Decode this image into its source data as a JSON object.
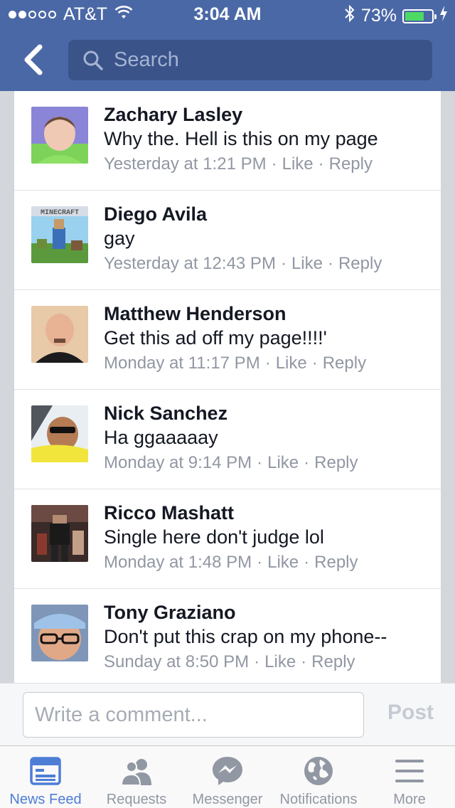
{
  "status_bar": {
    "carrier": "AT&T",
    "time": "3:04 AM",
    "battery": "73%",
    "signal_bars": 2,
    "battery_level": 0.73
  },
  "header": {
    "search_placeholder": "Search"
  },
  "comments": [
    {
      "name": "Zachary Lasley",
      "text": "Why the. Hell is this on my page",
      "time": "Yesterday at 1:21 PM",
      "like": "Like",
      "reply": "Reply"
    },
    {
      "name": "Diego Avila",
      "text": "gay",
      "time": "Yesterday at 12:43 PM",
      "like": "Like",
      "reply": "Reply",
      "avatar_text": "MINECRAFT"
    },
    {
      "name": "Matthew Henderson",
      "text": "Get this ad off my page!!!!'",
      "time": "Monday at 11:17 PM",
      "like": "Like",
      "reply": "Reply"
    },
    {
      "name": "Nick Sanchez",
      "text": "Ha ggaaaaay",
      "time": "Monday at 9:14 PM",
      "like": "Like",
      "reply": "Reply"
    },
    {
      "name": "Ricco Mashatt",
      "text": "Single here don't judge lol",
      "time": "Monday at 1:48 PM",
      "like": "Like",
      "reply": "Reply"
    },
    {
      "name": "Tony Graziano",
      "text": "Don't put this crap on my phone--",
      "time": "Sunday at 8:50 PM",
      "like": "Like",
      "reply": "Reply"
    }
  ],
  "compose": {
    "placeholder": "Write a comment...",
    "post_label": "Post"
  },
  "tabs": [
    {
      "label": "News Feed",
      "icon": "news-feed-icon",
      "active": true
    },
    {
      "label": "Requests",
      "icon": "friends-icon",
      "active": false
    },
    {
      "label": "Messenger",
      "icon": "messenger-icon",
      "active": false
    },
    {
      "label": "Notifications",
      "icon": "globe-icon",
      "active": false
    },
    {
      "label": "More",
      "icon": "menu-icon",
      "active": false
    }
  ],
  "colors": {
    "header": "#4b68a6",
    "search": "#3a5389",
    "active_tab": "#4e7dd6",
    "inactive": "#9197a3",
    "battery": "#4cd964"
  }
}
